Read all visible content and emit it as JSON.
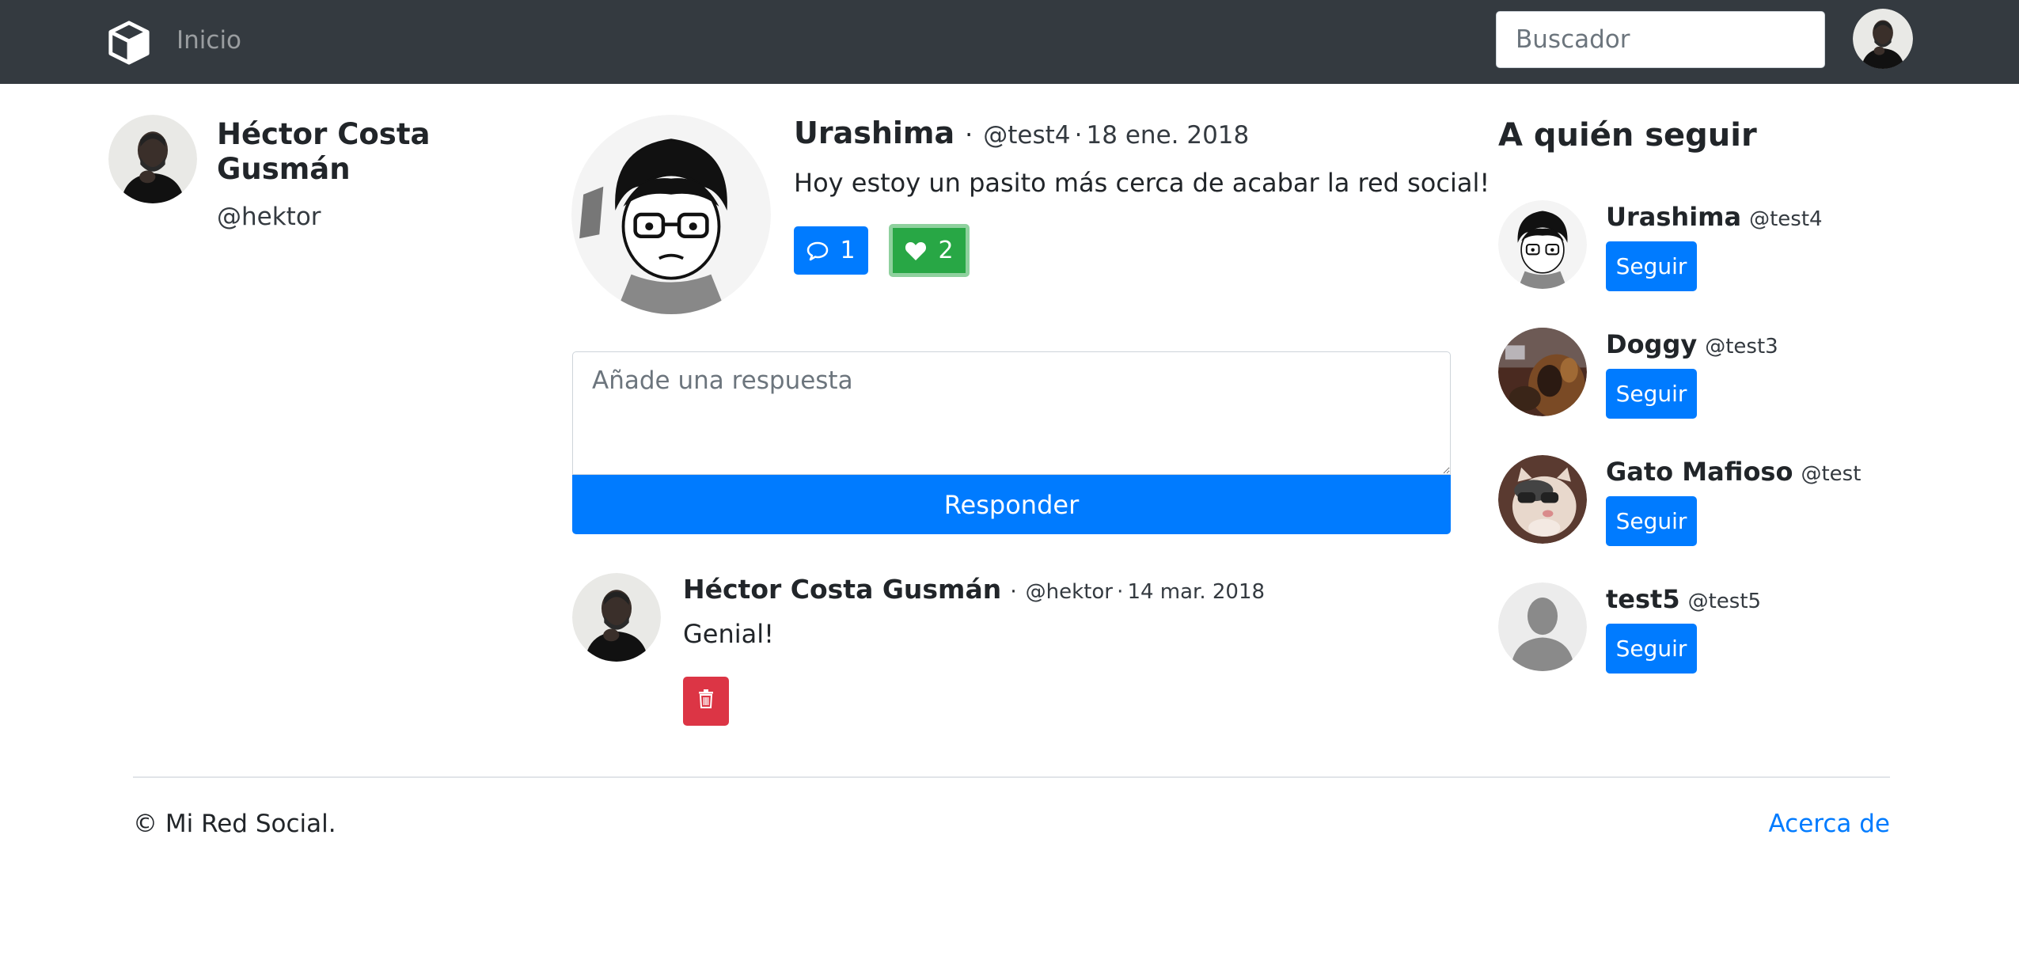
{
  "nav": {
    "home_label": "Inicio",
    "search_placeholder": "Buscador"
  },
  "profile": {
    "name": "Héctor Costa Gusmán",
    "handle": "@hektor"
  },
  "post": {
    "author_name": "Urashima",
    "author_handle": "@test4",
    "date": "18 ene. 2018",
    "separator": "·",
    "text": "Hoy estoy un pasito más cerca de acabar la red social!",
    "comment_count": "1",
    "like_count": "2"
  },
  "reply_form": {
    "placeholder": "Añade una respuesta",
    "submit_label": "Responder"
  },
  "replies": [
    {
      "author_name": "Héctor Costa Gusmán",
      "author_handle": "@hektor",
      "date": "14 mar. 2018",
      "separator": "·",
      "text": "Genial!"
    }
  ],
  "who_to_follow": {
    "title": "A quién seguir",
    "users": [
      {
        "name": "Urashima",
        "handle": "@test4",
        "button": "Seguir"
      },
      {
        "name": "Doggy",
        "handle": "@test3",
        "button": "Seguir"
      },
      {
        "name": "Gato Mafioso",
        "handle": "@test",
        "button": "Seguir"
      },
      {
        "name": "test5",
        "handle": "@test5",
        "button": "Seguir"
      }
    ]
  },
  "footer": {
    "copyright": "© Mi Red Social.",
    "about_link": "Acerca de"
  },
  "colors": {
    "navbar": "#343a40",
    "primary": "#007bff",
    "success": "#28a745",
    "danger": "#dc3545"
  },
  "icons": {
    "brand": "box-icon",
    "comment": "speech-bubble-icon",
    "like": "heart-icon",
    "delete": "trash-icon"
  }
}
